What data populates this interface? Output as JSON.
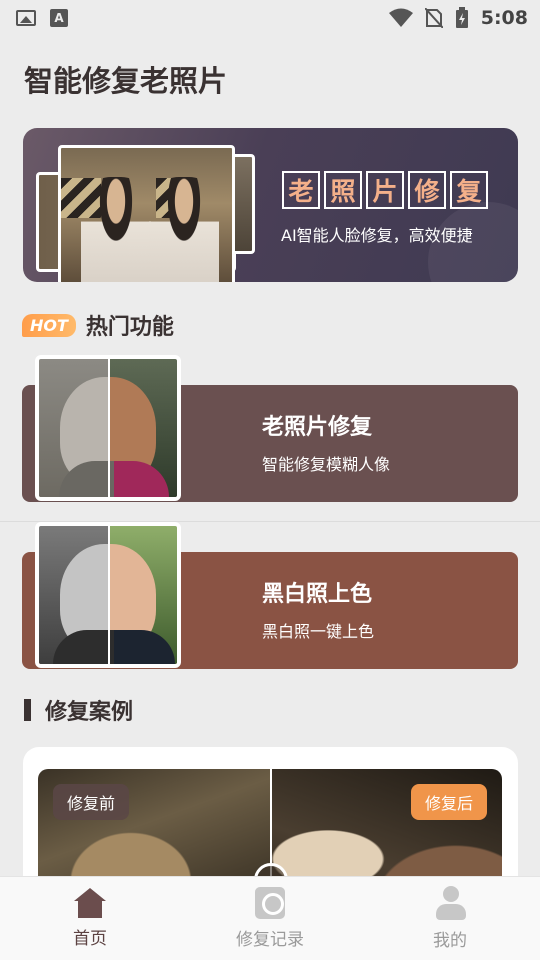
{
  "status_bar": {
    "time": "5:08",
    "a_label": "A"
  },
  "header": {
    "title": "智能修复老照片"
  },
  "banner": {
    "title_chars": [
      "老",
      "照",
      "片",
      "修",
      "复"
    ],
    "subtitle": "AI智能人脸修复，高效便捷"
  },
  "hot_section": {
    "badge": "HOT",
    "title": "热门功能"
  },
  "features": [
    {
      "title": "老照片修复",
      "subtitle": "智能修复模糊人像",
      "color": "#6a5050"
    },
    {
      "title": "黑白照上色",
      "subtitle": "黑白照一键上色",
      "color": "#8a5344"
    }
  ],
  "cases_section": {
    "title": "修复案例",
    "before_label": "修复前",
    "after_label": "修复后"
  },
  "bottom_nav": {
    "items": [
      {
        "label": "首页",
        "icon": "home-icon",
        "active": true
      },
      {
        "label": "修复记录",
        "icon": "record-icon",
        "active": false
      },
      {
        "label": "我的",
        "icon": "user-icon",
        "active": false
      }
    ]
  },
  "colors": {
    "accent": "#f0954a",
    "primary": "#5c4242"
  }
}
